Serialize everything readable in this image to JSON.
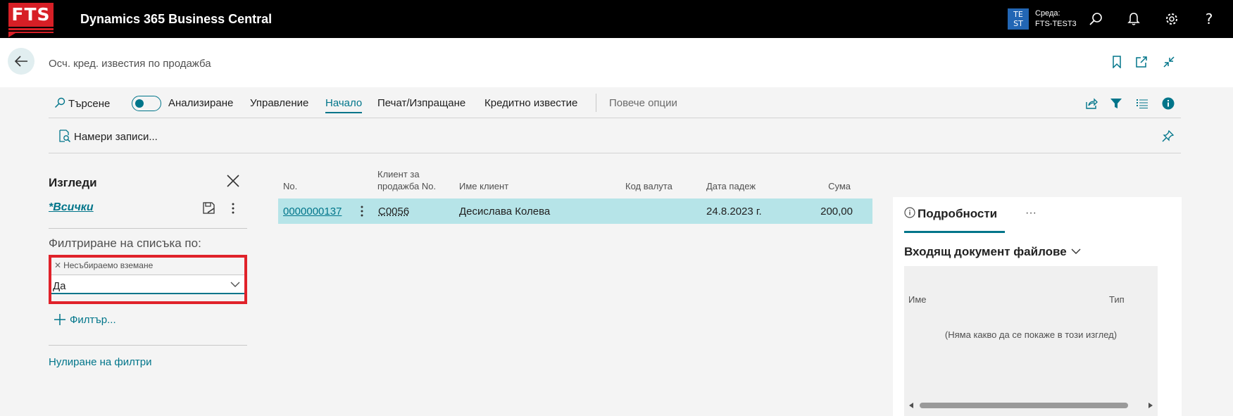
{
  "app": {
    "logo_text": "FTS",
    "title": "Dynamics 365 Business Central",
    "env_badge_line1": "TE",
    "env_badge_line2": "ST",
    "env_label": "Среда:",
    "env_name": "FTS-TEST3",
    "icons": [
      "search-icon",
      "bell-icon",
      "gear-icon",
      "help-icon"
    ]
  },
  "header": {
    "page_title": "Осч. кред. известия по продажба",
    "icons": [
      "bookmark-icon",
      "open-new-window-icon",
      "collapse-icon"
    ]
  },
  "actions": {
    "search": "Търсене",
    "analyze": "Анализиране",
    "manage": "Управление",
    "home": "Начало",
    "print_send": "Печат/Изпращане",
    "credit_memo": "Кредитно известие",
    "more_options": "Повече опции",
    "right_icons": [
      "share-icon",
      "filter-icon",
      "list-view-icon",
      "info-icon"
    ]
  },
  "subbar": {
    "find_records": "Намери записи..."
  },
  "filter_pane": {
    "title": "Изгледи",
    "view_all": "*Всички",
    "filter_list_by": "Филтриране на списъка по:",
    "field_name": "Несъбираемо вземане",
    "field_value": "Да",
    "add_filter": "Филтър...",
    "reset_filters": "Нулиране на филтри"
  },
  "grid": {
    "headers": {
      "no": "No.",
      "customer_no_line1": "Клиент за",
      "customer_no_line2": "продажба No.",
      "customer_name": "Име клиент",
      "currency_code": "Код валута",
      "due_date": "Дата падеж",
      "amount": "Сума"
    },
    "rows": [
      {
        "no": "0000000137",
        "customer_no": "C0056",
        "customer_name": "Десислава Колева",
        "currency_code": "",
        "due_date": "24.8.2023 г.",
        "amount": "200,00"
      }
    ]
  },
  "factbox": {
    "tab_label": "Подробности",
    "more": "···",
    "part_title": "Входящ документ файлове",
    "col_name": "Име",
    "col_type": "Тип",
    "empty_message": "(Няма какво да се покаже в този изглед)"
  },
  "colors": {
    "accent": "#00758a",
    "selected_row": "#b6e4e8",
    "highlight_border": "#e0222a",
    "brand": "#d71f26"
  }
}
